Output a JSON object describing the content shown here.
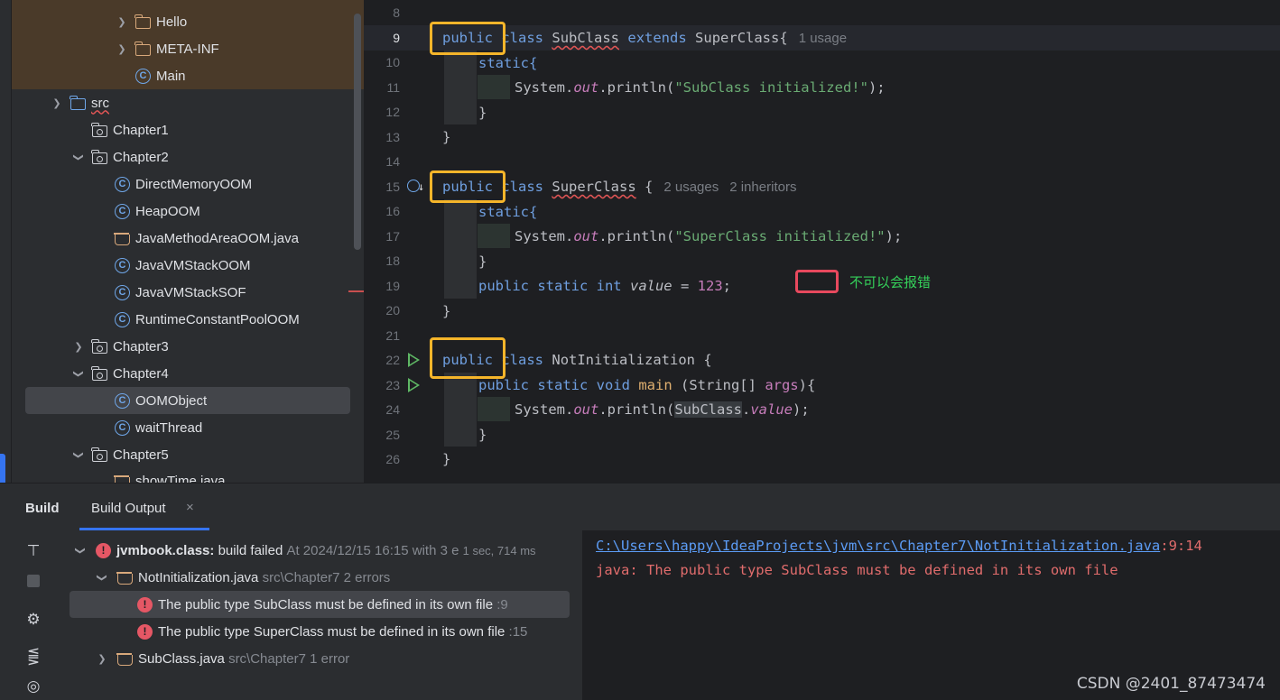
{
  "project_tree": {
    "top_items": [
      {
        "label": "Hello",
        "icon": "folder-icon"
      },
      {
        "label": "META-INF",
        "icon": "folder-icon"
      },
      {
        "label": "Main",
        "icon": "class-icon"
      }
    ],
    "src": {
      "label": "src"
    },
    "packages": [
      {
        "label": "Chapter1",
        "expanded": false
      },
      {
        "label": "Chapter2",
        "expanded": true
      },
      {
        "label": "Chapter3",
        "expanded": false
      },
      {
        "label": "Chapter4",
        "expanded": true
      },
      {
        "label": "Chapter5",
        "expanded": true
      }
    ],
    "chapter2_files": [
      "DirectMemoryOOM",
      "HeapOOM",
      "JavaMethodAreaOOM.java",
      "JavaVMStackOOM",
      "JavaVMStackSOF",
      "RuntimeConstantPoolOOM"
    ],
    "chapter4_files": [
      "OOMObject",
      "waitThread"
    ],
    "chapter5_files": [
      "showTime.java"
    ],
    "selected_item": "OOMObject"
  },
  "editor": {
    "line_numbers": [
      "8",
      "9",
      "10",
      "11",
      "12",
      "13",
      "14",
      "15",
      "16",
      "17",
      "18",
      "19",
      "20",
      "21",
      "22",
      "23",
      "24",
      "25",
      "26"
    ],
    "current_line": "9",
    "code": {
      "l9": {
        "kw1": "public",
        "kw2": "class",
        "name": "SubClass",
        "kw3": "extends",
        "parent": "SuperClass{",
        "hint": "1 usage"
      },
      "l10": "static{",
      "l11": {
        "obj": "System.",
        "field": "out",
        "call": ".println(",
        "str": "\"SubClass initialized!\"",
        "end": ");"
      },
      "l12": "}",
      "l13": "}",
      "l15": {
        "kw1": "public",
        "kw2": "class",
        "name": "SuperClass",
        "brace": " {",
        "hint1": "2 usages",
        "hint2": "2 inheritors"
      },
      "l16": "static{",
      "l17": {
        "obj": "System.",
        "field": "out",
        "call": ".println(",
        "str": "\"SuperClass initialized!\"",
        "end": ");"
      },
      "l18": "}",
      "l19": {
        "mods": "public static int",
        "field": "value",
        "eq": " = ",
        "num": "123",
        "end": ";"
      },
      "l20": "}",
      "l22": {
        "kw1": "public",
        "kw2": "class",
        "name": "NotInitialization {"
      },
      "l23": {
        "mods": "public static void",
        "method": "main",
        "args_open": " (String[] ",
        "param": "args",
        "args_close": "){"
      },
      "l24": {
        "obj": "System.",
        "field": "out",
        "call": ".println(",
        "ref": "SubClass",
        "dot": ".",
        "field2": "value",
        "end": ");"
      },
      "l25": "}",
      "l26": "}"
    },
    "annotation_note": "不可以会报错",
    "colors": {
      "orange_box": "#f5b52a",
      "red_box": "#e8495e",
      "note_green": "#35d05a"
    }
  },
  "build_panel": {
    "tabs": {
      "build": "Build",
      "build_output": "Build Output",
      "close": "×"
    },
    "tree": {
      "root": {
        "name": "jvmbook.class:",
        "status": "build failed",
        "meta": "At 2024/12/15 16:15 with 3 e",
        "duration": "1 sec, 714 ms"
      },
      "file1": {
        "name": "NotInitialization.java",
        "meta": "src\\Chapter7 2 errors"
      },
      "err1": {
        "text": "The public type SubClass must be defined in its own file",
        "line": ":9"
      },
      "err2": {
        "text": "The public type SuperClass must be defined in its own file",
        "line": ":15"
      },
      "file2": {
        "name": "SubClass.java",
        "meta": "src\\Chapter7 1 error"
      }
    },
    "output": {
      "path": "C:\\Users\\happy\\IdeaProjects\\jvm\\src\\Chapter7\\NotInitialization.java",
      "position": ":9:14",
      "message": "java: The public type SubClass must be defined in its own file"
    }
  },
  "watermark": "CSDN @2401_87473474"
}
